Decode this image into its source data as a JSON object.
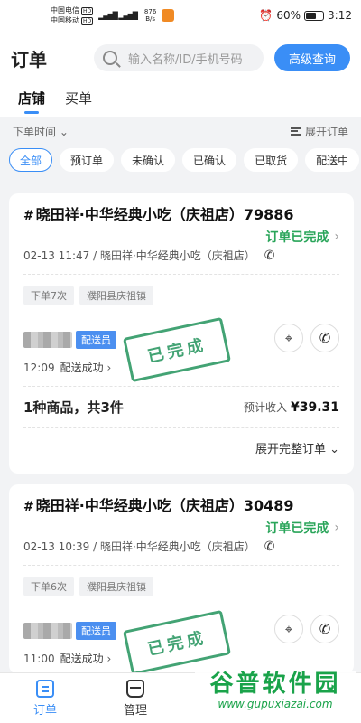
{
  "status_bar": {
    "carrier1": "中国电信",
    "carrier2": "中国移动",
    "hd": "HD",
    "net_speed": "876",
    "net_unit": "B/s",
    "battery": "60%",
    "battery_level": 0.6,
    "time": "3:12"
  },
  "header": {
    "title": "订单",
    "search_placeholder": "输入名称/ID/手机号码",
    "advanced_button": "高级查询"
  },
  "tabs": [
    {
      "label": "店铺",
      "active": true
    },
    {
      "label": "买单",
      "active": false
    }
  ],
  "filters": {
    "sort_label": "下单时间",
    "expand_all": "展开订单",
    "chips": [
      "全部",
      "预订单",
      "未确认",
      "已确认",
      "已取货",
      "配送中"
    ],
    "active_chip": "全部"
  },
  "orders": [
    {
      "title": "晓田祥·中华经典小吃（庆祖店）79886",
      "status": "订单已完成",
      "time_shop": "02-13 11:47 / 晓田祥·中华经典小吃（庆祖店）",
      "tags": [
        "下单7次",
        "濮阳县庆祖镇"
      ],
      "courier_role": "配送员",
      "delivered_time": "12:09",
      "delivered_status": "配送成功",
      "stamp": "已完成",
      "summary": "1种商品，共3件",
      "income_label": "预计收入",
      "income_value": "¥39.31",
      "expand_label": "展开完整订单"
    },
    {
      "title": "晓田祥·中华经典小吃（庆祖店）30489",
      "status": "订单已完成",
      "time_shop": "02-13 10:39 / 晓田祥·中华经典小吃（庆祖店）",
      "tags": [
        "下单6次",
        "濮阳县庆祖镇"
      ],
      "courier_role": "配送员",
      "delivered_time": "11:00",
      "delivered_status": "配送成功",
      "stamp": "已完成"
    }
  ],
  "bottom_nav": [
    {
      "label": "订单",
      "icon": "orders-icon",
      "active": true
    },
    {
      "label": "管理",
      "icon": "manage-icon",
      "active": false
    }
  ],
  "watermark": {
    "title": "谷普软件园",
    "url": "www.gupuxiazai.com"
  },
  "colors": {
    "accent": "#3a8ef6",
    "success": "#2aa55a"
  }
}
